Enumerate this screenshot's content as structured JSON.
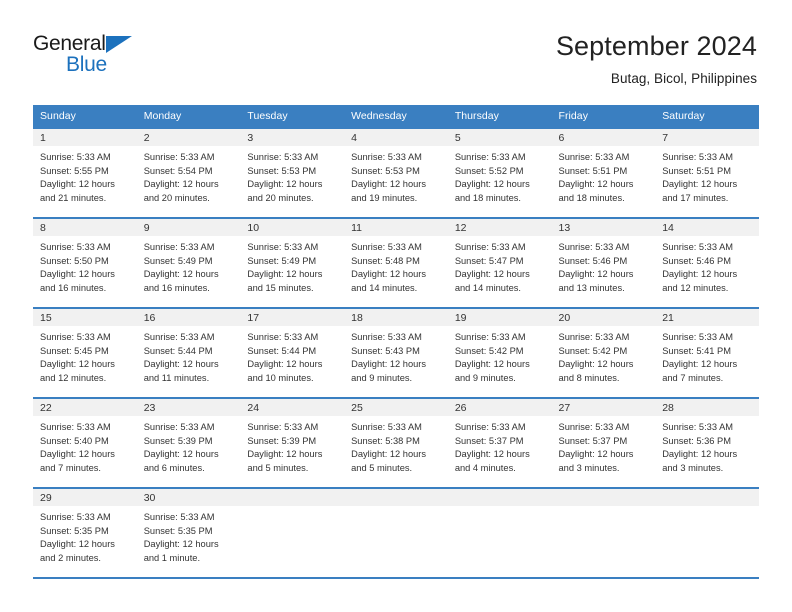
{
  "branding": {
    "name_top": "General",
    "name_bottom": "Blue",
    "triangle_color": "#1c71bd"
  },
  "header": {
    "title": "September 2024",
    "subtitle": "Butag, Bicol, Philippines"
  },
  "colors": {
    "header_blue": "#3a7fc1",
    "daynum_band": "#f1f1f1",
    "text": "#333333"
  },
  "weekday_headers": [
    "Sunday",
    "Monday",
    "Tuesday",
    "Wednesday",
    "Thursday",
    "Friday",
    "Saturday"
  ],
  "weeks": [
    [
      {
        "day": "1",
        "sunrise": "Sunrise: 5:33 AM",
        "sunset": "Sunset: 5:55 PM",
        "daylight": "Daylight: 12 hours and 21 minutes."
      },
      {
        "day": "2",
        "sunrise": "Sunrise: 5:33 AM",
        "sunset": "Sunset: 5:54 PM",
        "daylight": "Daylight: 12 hours and 20 minutes."
      },
      {
        "day": "3",
        "sunrise": "Sunrise: 5:33 AM",
        "sunset": "Sunset: 5:53 PM",
        "daylight": "Daylight: 12 hours and 20 minutes."
      },
      {
        "day": "4",
        "sunrise": "Sunrise: 5:33 AM",
        "sunset": "Sunset: 5:53 PM",
        "daylight": "Daylight: 12 hours and 19 minutes."
      },
      {
        "day": "5",
        "sunrise": "Sunrise: 5:33 AM",
        "sunset": "Sunset: 5:52 PM",
        "daylight": "Daylight: 12 hours and 18 minutes."
      },
      {
        "day": "6",
        "sunrise": "Sunrise: 5:33 AM",
        "sunset": "Sunset: 5:51 PM",
        "daylight": "Daylight: 12 hours and 18 minutes."
      },
      {
        "day": "7",
        "sunrise": "Sunrise: 5:33 AM",
        "sunset": "Sunset: 5:51 PM",
        "daylight": "Daylight: 12 hours and 17 minutes."
      }
    ],
    [
      {
        "day": "8",
        "sunrise": "Sunrise: 5:33 AM",
        "sunset": "Sunset: 5:50 PM",
        "daylight": "Daylight: 12 hours and 16 minutes."
      },
      {
        "day": "9",
        "sunrise": "Sunrise: 5:33 AM",
        "sunset": "Sunset: 5:49 PM",
        "daylight": "Daylight: 12 hours and 16 minutes."
      },
      {
        "day": "10",
        "sunrise": "Sunrise: 5:33 AM",
        "sunset": "Sunset: 5:49 PM",
        "daylight": "Daylight: 12 hours and 15 minutes."
      },
      {
        "day": "11",
        "sunrise": "Sunrise: 5:33 AM",
        "sunset": "Sunset: 5:48 PM",
        "daylight": "Daylight: 12 hours and 14 minutes."
      },
      {
        "day": "12",
        "sunrise": "Sunrise: 5:33 AM",
        "sunset": "Sunset: 5:47 PM",
        "daylight": "Daylight: 12 hours and 14 minutes."
      },
      {
        "day": "13",
        "sunrise": "Sunrise: 5:33 AM",
        "sunset": "Sunset: 5:46 PM",
        "daylight": "Daylight: 12 hours and 13 minutes."
      },
      {
        "day": "14",
        "sunrise": "Sunrise: 5:33 AM",
        "sunset": "Sunset: 5:46 PM",
        "daylight": "Daylight: 12 hours and 12 minutes."
      }
    ],
    [
      {
        "day": "15",
        "sunrise": "Sunrise: 5:33 AM",
        "sunset": "Sunset: 5:45 PM",
        "daylight": "Daylight: 12 hours and 12 minutes."
      },
      {
        "day": "16",
        "sunrise": "Sunrise: 5:33 AM",
        "sunset": "Sunset: 5:44 PM",
        "daylight": "Daylight: 12 hours and 11 minutes."
      },
      {
        "day": "17",
        "sunrise": "Sunrise: 5:33 AM",
        "sunset": "Sunset: 5:44 PM",
        "daylight": "Daylight: 12 hours and 10 minutes."
      },
      {
        "day": "18",
        "sunrise": "Sunrise: 5:33 AM",
        "sunset": "Sunset: 5:43 PM",
        "daylight": "Daylight: 12 hours and 9 minutes."
      },
      {
        "day": "19",
        "sunrise": "Sunrise: 5:33 AM",
        "sunset": "Sunset: 5:42 PM",
        "daylight": "Daylight: 12 hours and 9 minutes."
      },
      {
        "day": "20",
        "sunrise": "Sunrise: 5:33 AM",
        "sunset": "Sunset: 5:42 PM",
        "daylight": "Daylight: 12 hours and 8 minutes."
      },
      {
        "day": "21",
        "sunrise": "Sunrise: 5:33 AM",
        "sunset": "Sunset: 5:41 PM",
        "daylight": "Daylight: 12 hours and 7 minutes."
      }
    ],
    [
      {
        "day": "22",
        "sunrise": "Sunrise: 5:33 AM",
        "sunset": "Sunset: 5:40 PM",
        "daylight": "Daylight: 12 hours and 7 minutes."
      },
      {
        "day": "23",
        "sunrise": "Sunrise: 5:33 AM",
        "sunset": "Sunset: 5:39 PM",
        "daylight": "Daylight: 12 hours and 6 minutes."
      },
      {
        "day": "24",
        "sunrise": "Sunrise: 5:33 AM",
        "sunset": "Sunset: 5:39 PM",
        "daylight": "Daylight: 12 hours and 5 minutes."
      },
      {
        "day": "25",
        "sunrise": "Sunrise: 5:33 AM",
        "sunset": "Sunset: 5:38 PM",
        "daylight": "Daylight: 12 hours and 5 minutes."
      },
      {
        "day": "26",
        "sunrise": "Sunrise: 5:33 AM",
        "sunset": "Sunset: 5:37 PM",
        "daylight": "Daylight: 12 hours and 4 minutes."
      },
      {
        "day": "27",
        "sunrise": "Sunrise: 5:33 AM",
        "sunset": "Sunset: 5:37 PM",
        "daylight": "Daylight: 12 hours and 3 minutes."
      },
      {
        "day": "28",
        "sunrise": "Sunrise: 5:33 AM",
        "sunset": "Sunset: 5:36 PM",
        "daylight": "Daylight: 12 hours and 3 minutes."
      }
    ],
    [
      {
        "day": "29",
        "sunrise": "Sunrise: 5:33 AM",
        "sunset": "Sunset: 5:35 PM",
        "daylight": "Daylight: 12 hours and 2 minutes."
      },
      {
        "day": "30",
        "sunrise": "Sunrise: 5:33 AM",
        "sunset": "Sunset: 5:35 PM",
        "daylight": "Daylight: 12 hours and 1 minute."
      },
      {
        "day": "",
        "sunrise": "",
        "sunset": "",
        "daylight": ""
      },
      {
        "day": "",
        "sunrise": "",
        "sunset": "",
        "daylight": ""
      },
      {
        "day": "",
        "sunrise": "",
        "sunset": "",
        "daylight": ""
      },
      {
        "day": "",
        "sunrise": "",
        "sunset": "",
        "daylight": ""
      },
      {
        "day": "",
        "sunrise": "",
        "sunset": "",
        "daylight": ""
      }
    ]
  ]
}
